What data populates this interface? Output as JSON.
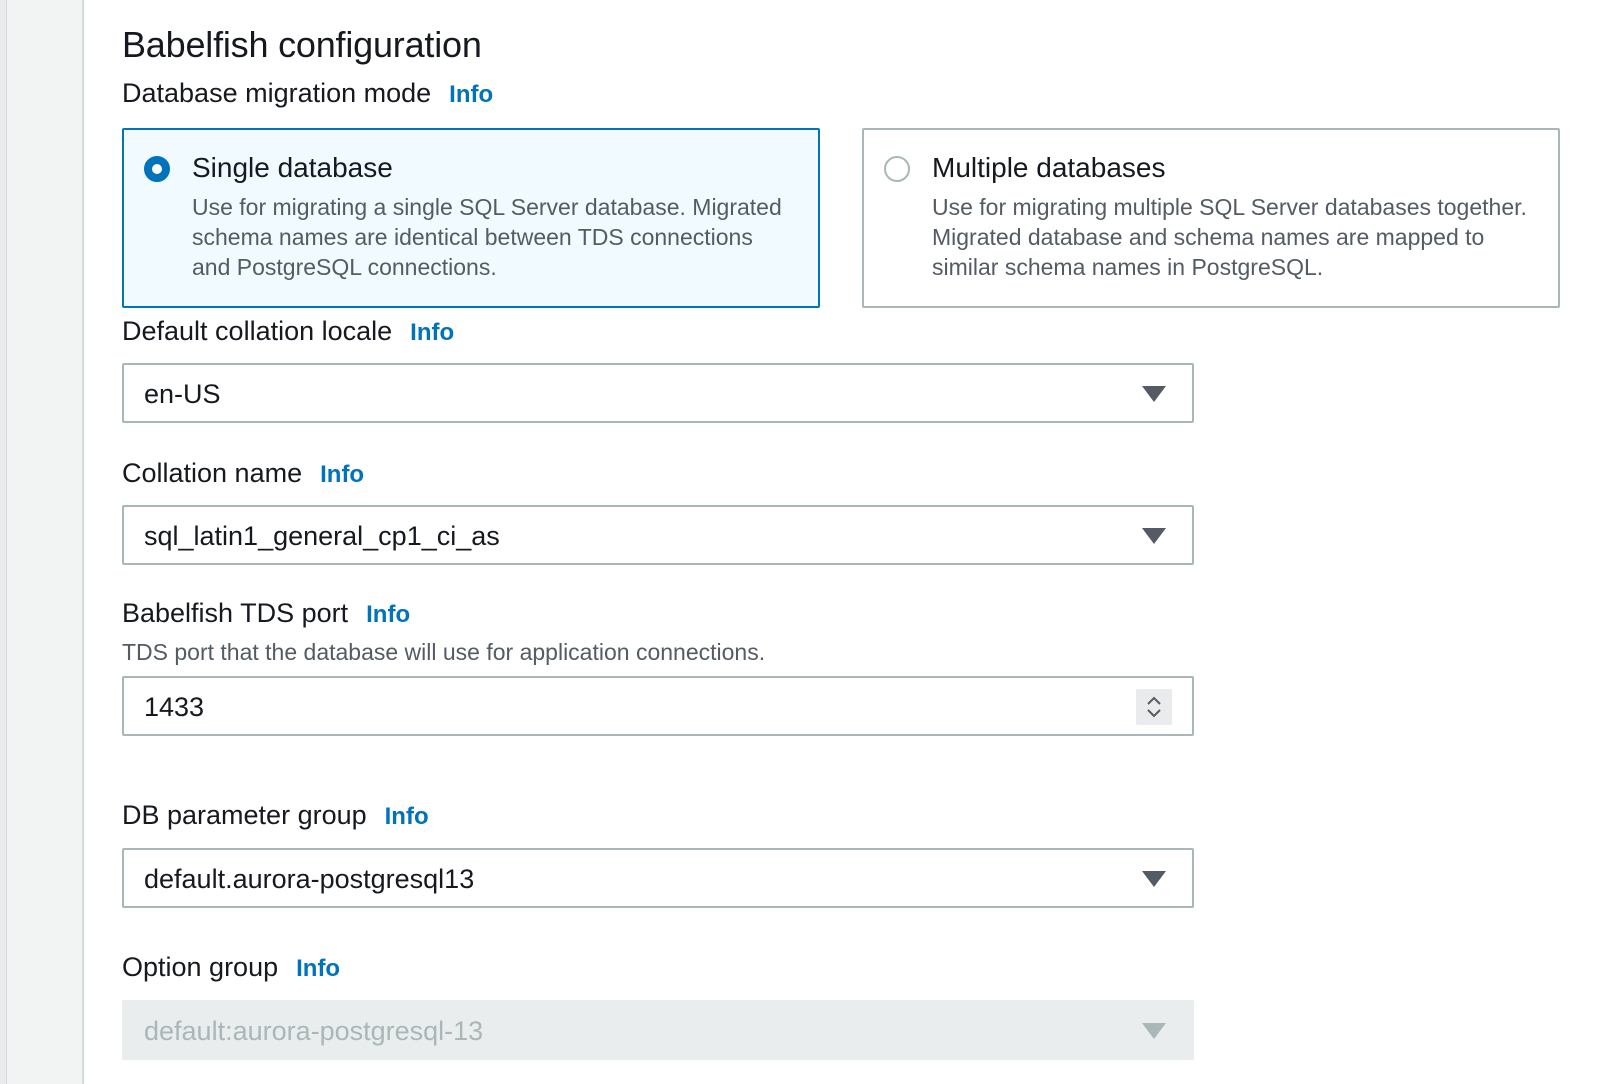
{
  "section": {
    "title": "Babelfish configuration"
  },
  "migration_mode": {
    "label": "Database migration mode",
    "info": "Info",
    "options": [
      {
        "title": "Single database",
        "description": "Use for migrating a single SQL Server database. Migrated schema names are identical between TDS connections and PostgreSQL connections.",
        "selected": true
      },
      {
        "title": "Multiple databases",
        "description": "Use for migrating multiple SQL Server databases together. Migrated database and schema names are mapped to similar schema names in PostgreSQL.",
        "selected": false
      }
    ]
  },
  "collation_locale": {
    "label": "Default collation locale",
    "info": "Info",
    "value": "en-US"
  },
  "collation_name": {
    "label": "Collation name",
    "info": "Info",
    "value": "sql_latin1_general_cp1_ci_as"
  },
  "tds_port": {
    "label": "Babelfish TDS port",
    "info": "Info",
    "description": "TDS port that the database will use for application connections.",
    "value": "1433"
  },
  "db_parameter_group": {
    "label": "DB parameter group",
    "info": "Info",
    "value": "default.aurora-postgresql13"
  },
  "option_group": {
    "label": "Option group",
    "info": "Info",
    "value": "default:aurora-postgresql-13",
    "disabled": true
  },
  "colors": {
    "accent": "#0073bb",
    "border": "#aab7b8",
    "disabled_bg": "#eaeded",
    "selected_bg": "#f1faff"
  }
}
